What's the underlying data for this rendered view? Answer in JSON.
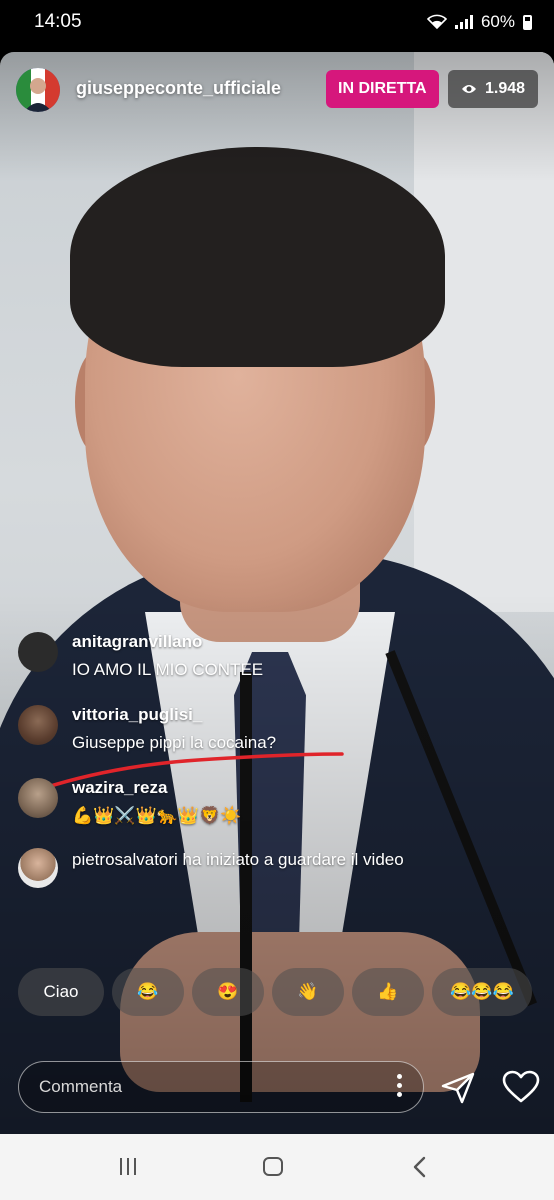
{
  "status_bar": {
    "time": "14:05",
    "battery": "60%"
  },
  "header": {
    "username": "giuseppeconte_ufficiale",
    "live_label": "IN DIRETTA",
    "viewer_count": "1.948"
  },
  "comments": [
    {
      "username": "anitagranvillano",
      "text": "IO AMO IL MIO CONTEE"
    },
    {
      "username": "vittoria_puglisi_",
      "text": "Giuseppe pippi la cocaina?"
    },
    {
      "username": "wazira_reza",
      "text": "💪👑⚔️👑🐆👑🦁☀️"
    },
    {
      "username": "pietrosalvatori",
      "text": "pietrosalvatori ha iniziato a guardare il video"
    }
  ],
  "quick_reactions": [
    "Ciao",
    "😂",
    "😍",
    "👋",
    "👍",
    "😂😂😂"
  ],
  "comment_input": {
    "placeholder": "Commenta"
  },
  "colors": {
    "live_badge": "#d6177c",
    "annotation_line": "#e0242a",
    "nav_bar": "#f4f4f4"
  }
}
